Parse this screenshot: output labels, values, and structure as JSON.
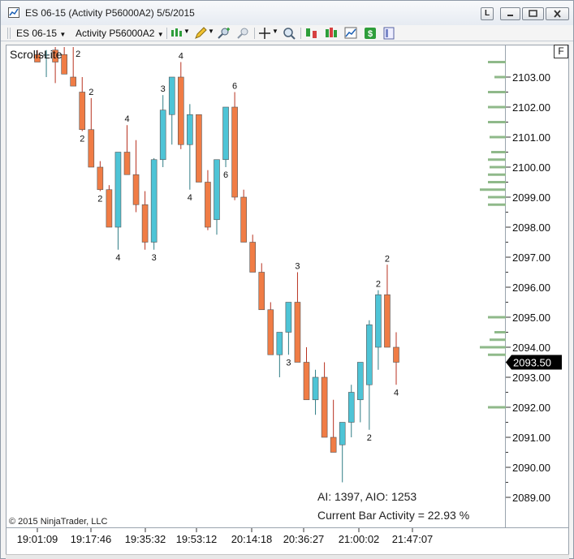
{
  "window": {
    "title": "ES 06-15 (Activity P56000A2)  5/5/2015",
    "link_button": "L"
  },
  "toolbar": {
    "instrument": "ES 06-15",
    "period": "Activity P56000A2",
    "icons": [
      "bar-style-icon",
      "pencil-draw-icon",
      "zoom-in-icon",
      "zoom-out-icon",
      "crosshair-icon",
      "magnifier-icon",
      "strategy-icon",
      "indicators-icon",
      "chart-properties-icon",
      "dollar-icon",
      "data-box-icon"
    ]
  },
  "chart": {
    "indicator_label": "ScrollsLite",
    "copyright": "© 2015 NinjaTrader, LLC",
    "ai_text": "AI: 1397,  AIO: 1253",
    "current_bar_activity": "Current Bar Activity = 22.93 %",
    "f_box": "F",
    "current_price_label": "2093.50",
    "colors": {
      "up": "#4ec4d6",
      "down": "#f07c45",
      "up_wick": "#2f7d86",
      "down_wick": "#b83220",
      "volume_profile": "#8fb98a",
      "price_tag_bg": "#000000"
    }
  },
  "chart_data": {
    "type": "candlestick",
    "y_axis": {
      "ylim": [
        2088.5,
        2103.9
      ],
      "ticks": [
        "2103.00",
        "2102.00",
        "2101.00",
        "2100.00",
        "2099.00",
        "2098.00",
        "2097.00",
        "2096.00",
        "2095.00",
        "2094.00",
        "2093.00",
        "2092.00",
        "2091.00",
        "2090.00",
        "2089.00"
      ]
    },
    "x_axis": {
      "ticks": [
        "19:01:09",
        "19:17:46",
        "19:35:32",
        "19:53:12",
        "20:14:18",
        "20:36:27",
        "21:00:02",
        "21:47:07"
      ]
    },
    "candles": [
      {
        "o": 2103.75,
        "h": 2103.9,
        "l": 2103.5,
        "c": 2103.5,
        "ann": "",
        "ann_pos": "above"
      },
      {
        "o": 2103.75,
        "h": 2103.9,
        "l": 2103.0,
        "c": 2103.75,
        "ann": "",
        "ann_pos": "above"
      },
      {
        "o": 2103.9,
        "h": 2104.0,
        "l": 2102.8,
        "c": 2103.5,
        "ann": "",
        "ann_pos": "above"
      },
      {
        "o": 2103.75,
        "h": 2104.0,
        "l": 2103.1,
        "c": 2103.1,
        "ann": "",
        "ann_pos": "above"
      },
      {
        "o": 2103.0,
        "h": 2104.0,
        "l": 2102.7,
        "c": 2102.7,
        "ann": "2",
        "ann_pos": "above"
      },
      {
        "o": 2102.5,
        "h": 2103.0,
        "l": 2101.2,
        "c": 2101.25,
        "ann": "2",
        "ann_pos": "below"
      },
      {
        "o": 2101.25,
        "h": 2102.3,
        "l": 2100.0,
        "c": 2100.0,
        "ann": "2",
        "ann_pos": "above"
      },
      {
        "o": 2100.0,
        "h": 2100.2,
        "l": 2099.2,
        "c": 2099.25,
        "ann": "2",
        "ann_pos": "below"
      },
      {
        "o": 2099.25,
        "h": 2099.4,
        "l": 2098.0,
        "c": 2098.0,
        "ann": "",
        "ann_pos": "above"
      },
      {
        "o": 2098.0,
        "h": 2100.5,
        "l": 2097.25,
        "c": 2100.5,
        "ann": "4",
        "ann_pos": "below"
      },
      {
        "o": 2100.5,
        "h": 2101.4,
        "l": 2099.75,
        "c": 2099.75,
        "ann": "4",
        "ann_pos": "above"
      },
      {
        "o": 2099.75,
        "h": 2100.9,
        "l": 2098.5,
        "c": 2098.75,
        "ann": "",
        "ann_pos": "above"
      },
      {
        "o": 2098.75,
        "h": 2099.2,
        "l": 2097.25,
        "c": 2097.5,
        "ann": "",
        "ann_pos": "above"
      },
      {
        "o": 2097.5,
        "h": 2100.3,
        "l": 2097.25,
        "c": 2100.25,
        "ann": "3",
        "ann_pos": "below"
      },
      {
        "o": 2100.25,
        "h": 2102.4,
        "l": 2100.0,
        "c": 2101.9,
        "ann": "3",
        "ann_pos": "above"
      },
      {
        "o": 2101.75,
        "h": 2103.0,
        "l": 2100.75,
        "c": 2103.0,
        "ann": "",
        "ann_pos": "above"
      },
      {
        "o": 2103.0,
        "h": 2103.5,
        "l": 2100.6,
        "c": 2100.75,
        "ann": "4",
        "ann_pos": "above"
      },
      {
        "o": 2100.75,
        "h": 2102.1,
        "l": 2099.25,
        "c": 2101.75,
        "ann": "4",
        "ann_pos": "below"
      },
      {
        "o": 2101.75,
        "h": 2101.75,
        "l": 2099.5,
        "c": 2099.5,
        "ann": "",
        "ann_pos": "above"
      },
      {
        "o": 2099.5,
        "h": 2099.9,
        "l": 2097.9,
        "c": 2098.0,
        "ann": "",
        "ann_pos": "above"
      },
      {
        "o": 2098.25,
        "h": 2100.25,
        "l": 2097.75,
        "c": 2100.25,
        "ann": "",
        "ann_pos": "above"
      },
      {
        "o": 2100.25,
        "h": 2102.0,
        "l": 2100.0,
        "c": 2102.0,
        "ann": "6",
        "ann_pos": "below"
      },
      {
        "o": 2102.0,
        "h": 2102.5,
        "l": 2098.9,
        "c": 2099.0,
        "ann": "6",
        "ann_pos": "above"
      },
      {
        "o": 2099.0,
        "h": 2099.25,
        "l": 2097.5,
        "c": 2097.5,
        "ann": "",
        "ann_pos": "above"
      },
      {
        "o": 2097.5,
        "h": 2097.75,
        "l": 2096.5,
        "c": 2096.5,
        "ann": "",
        "ann_pos": "above"
      },
      {
        "o": 2096.5,
        "h": 2096.8,
        "l": 2095.25,
        "c": 2095.25,
        "ann": "",
        "ann_pos": "above"
      },
      {
        "o": 2095.25,
        "h": 2095.5,
        "l": 2093.75,
        "c": 2093.75,
        "ann": "",
        "ann_pos": "above"
      },
      {
        "o": 2093.75,
        "h": 2094.5,
        "l": 2093.0,
        "c": 2094.5,
        "ann": "",
        "ann_pos": "above"
      },
      {
        "o": 2094.5,
        "h": 2095.5,
        "l": 2093.75,
        "c": 2095.5,
        "ann": "3",
        "ann_pos": "below"
      },
      {
        "o": 2095.5,
        "h": 2096.5,
        "l": 2093.5,
        "c": 2093.5,
        "ann": "3",
        "ann_pos": "above"
      },
      {
        "o": 2093.5,
        "h": 2094.0,
        "l": 2092.25,
        "c": 2092.25,
        "ann": "",
        "ann_pos": "above"
      },
      {
        "o": 2092.25,
        "h": 2093.25,
        "l": 2091.75,
        "c": 2093.0,
        "ann": "",
        "ann_pos": "above"
      },
      {
        "o": 2093.0,
        "h": 2093.5,
        "l": 2091.0,
        "c": 2091.0,
        "ann": "",
        "ann_pos": "above"
      },
      {
        "o": 2091.0,
        "h": 2092.25,
        "l": 2090.5,
        "c": 2090.5,
        "ann": "",
        "ann_pos": "above"
      },
      {
        "o": 2090.75,
        "h": 2091.5,
        "l": 2089.5,
        "c": 2091.5,
        "ann": "",
        "ann_pos": "above"
      },
      {
        "o": 2091.5,
        "h": 2092.75,
        "l": 2091.0,
        "c": 2092.5,
        "ann": "",
        "ann_pos": "above"
      },
      {
        "o": 2092.25,
        "h": 2093.5,
        "l": 2091.5,
        "c": 2093.5,
        "ann": "",
        "ann_pos": "above"
      },
      {
        "o": 2092.75,
        "h": 2094.9,
        "l": 2091.25,
        "c": 2094.75,
        "ann": "2",
        "ann_pos": "below"
      },
      {
        "o": 2094.0,
        "h": 2095.9,
        "l": 2093.25,
        "c": 2095.75,
        "ann": "2",
        "ann_pos": "above"
      },
      {
        "o": 2095.75,
        "h": 2096.75,
        "l": 2094.0,
        "c": 2094.0,
        "ann": "2",
        "ann_pos": "above"
      },
      {
        "o": 2094.0,
        "h": 2094.5,
        "l": 2092.75,
        "c": 2093.5,
        "ann": "4",
        "ann_pos": "below"
      }
    ],
    "volume_profile": [
      {
        "price": 2103.5,
        "size": 22
      },
      {
        "price": 2103.0,
        "size": 14
      },
      {
        "price": 2102.5,
        "size": 22
      },
      {
        "price": 2102.0,
        "size": 22
      },
      {
        "price": 2101.5,
        "size": 22
      },
      {
        "price": 2101.0,
        "size": 20
      },
      {
        "price": 2100.5,
        "size": 18
      },
      {
        "price": 2100.25,
        "size": 22
      },
      {
        "price": 2100.0,
        "size": 20
      },
      {
        "price": 2099.75,
        "size": 22
      },
      {
        "price": 2099.5,
        "size": 22
      },
      {
        "price": 2099.25,
        "size": 32
      },
      {
        "price": 2099.0,
        "size": 22
      },
      {
        "price": 2098.75,
        "size": 22
      },
      {
        "price": 2095.0,
        "size": 22
      },
      {
        "price": 2094.5,
        "size": 14
      },
      {
        "price": 2094.25,
        "size": 20
      },
      {
        "price": 2094.0,
        "size": 32
      },
      {
        "price": 2093.75,
        "size": 22
      },
      {
        "price": 2092.0,
        "size": 22
      }
    ]
  }
}
